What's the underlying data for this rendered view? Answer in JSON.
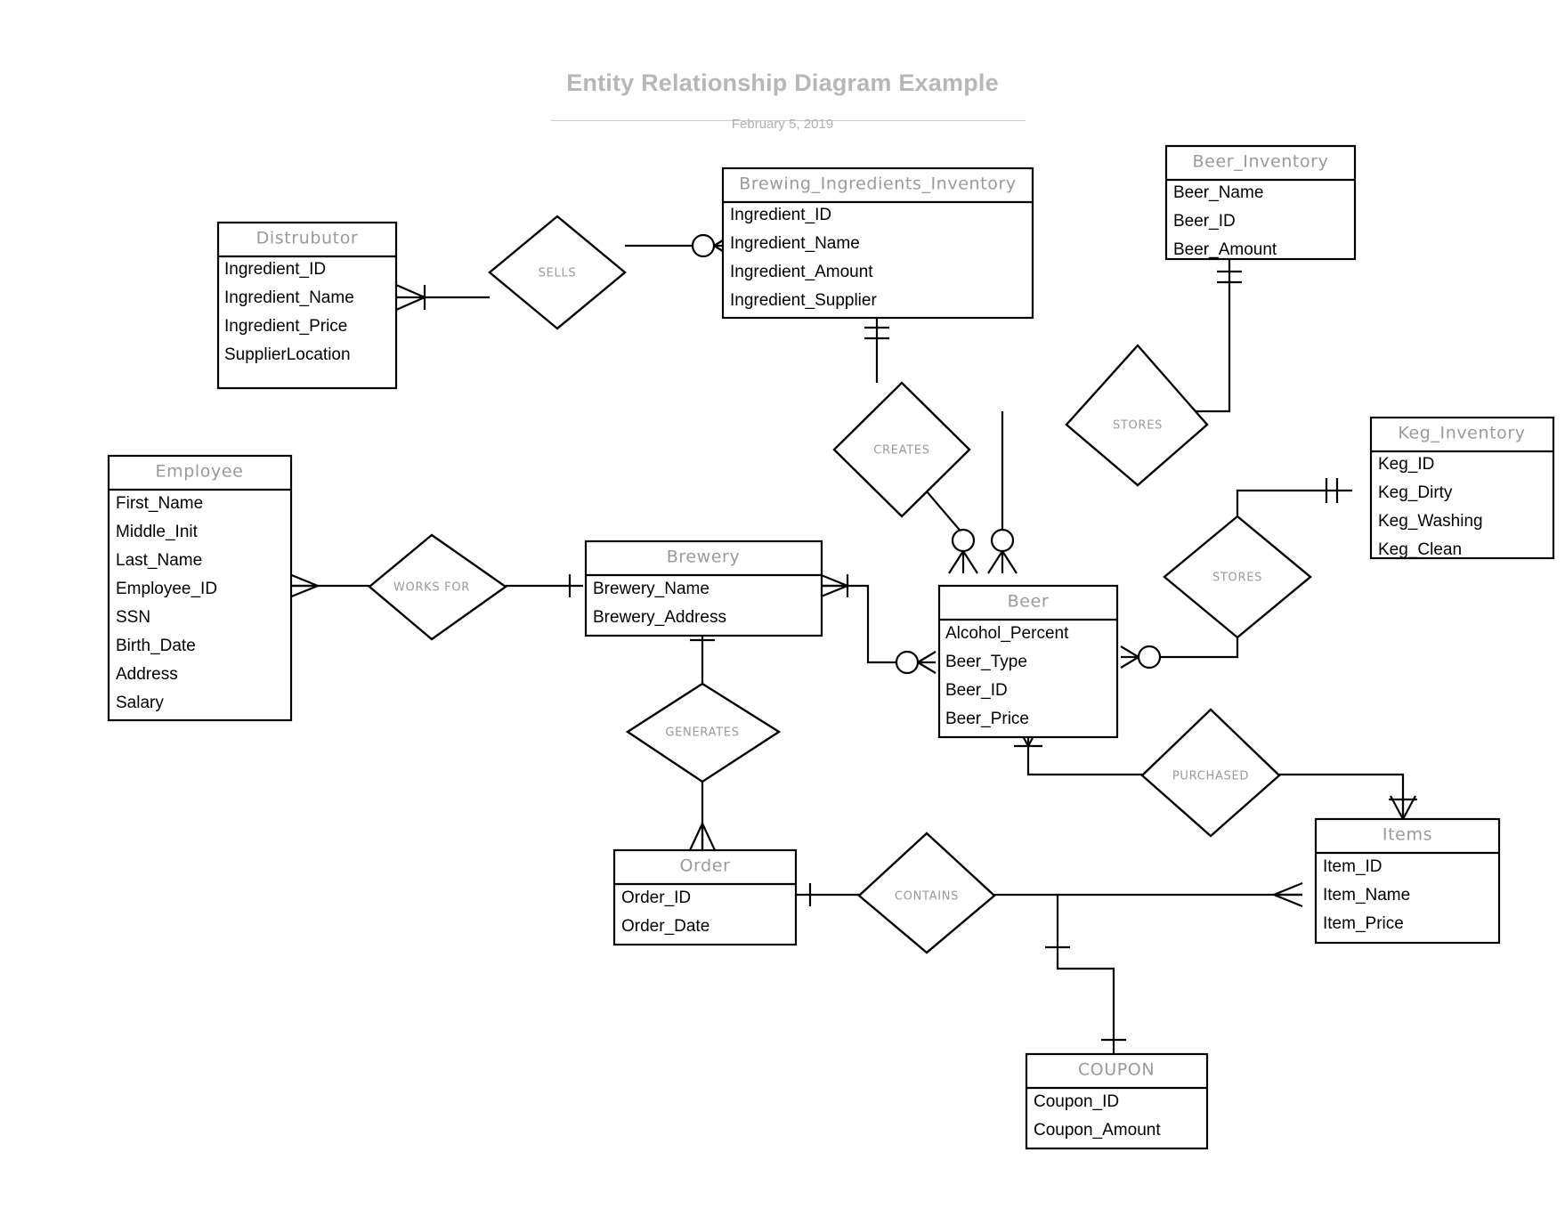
{
  "header": {
    "title": "Entity Relationship Diagram Example",
    "date": "February 5, 2019"
  },
  "colors": {
    "title_gray": "#b7b7b7",
    "entity_title_gray": "#9a9a9a",
    "attribute_black": "#000000",
    "line_black": "#000000",
    "background": "#ffffff"
  },
  "entities": {
    "distrubutor": {
      "title": "Distrubutor",
      "attributes": [
        "Ingredient_ID",
        "Ingredient_Name",
        "Ingredient_Price",
        "SupplierLocation"
      ]
    },
    "brewing_ingredients_inventory": {
      "title": "Brewing_Ingredients_Inventory",
      "attributes": [
        "Ingredient_ID",
        "Ingredient_Name",
        "Ingredient_Amount",
        "Ingredient_Supplier"
      ]
    },
    "beer_inventory": {
      "title": "Beer_Inventory",
      "attributes": [
        "Beer_Name",
        "Beer_ID",
        "Beer_Amount"
      ]
    },
    "keg_inventory": {
      "title": "Keg_Inventory",
      "attributes": [
        "Keg_ID",
        "Keg_Dirty",
        "Keg_Washing",
        "Keg_Clean"
      ]
    },
    "employee": {
      "title": "Employee",
      "attributes": [
        "First_Name",
        "Middle_Init",
        "Last_Name",
        "Employee_ID",
        "SSN",
        "Birth_Date",
        "Address",
        "Salary"
      ]
    },
    "brewery": {
      "title": "Brewery",
      "attributes": [
        "Brewery_Name",
        "Brewery_Address"
      ]
    },
    "beer": {
      "title": "Beer",
      "attributes": [
        "Alcohol_Percent",
        "Beer_Type",
        "Beer_ID",
        "Beer_Price"
      ]
    },
    "order": {
      "title": "Order",
      "attributes": [
        "Order_ID",
        "Order_Date"
      ]
    },
    "items": {
      "title": "Items",
      "attributes": [
        "Item_ID",
        "Item_Name",
        "Item_Price"
      ]
    },
    "coupon": {
      "title": "COUPON",
      "attributes": [
        "Coupon_ID",
        "Coupon_Amount"
      ]
    }
  },
  "relationships": {
    "sells": {
      "label": "SELLS"
    },
    "creates": {
      "label": "CREATES"
    },
    "stores_beer": {
      "label": "STORES"
    },
    "stores_keg": {
      "label": "STORES"
    },
    "works_for": {
      "label": "WORKS FOR"
    },
    "generates": {
      "label": "GENERATES"
    },
    "purchased": {
      "label": "PURCHASED"
    },
    "contains": {
      "label": "CONTAINS"
    }
  }
}
